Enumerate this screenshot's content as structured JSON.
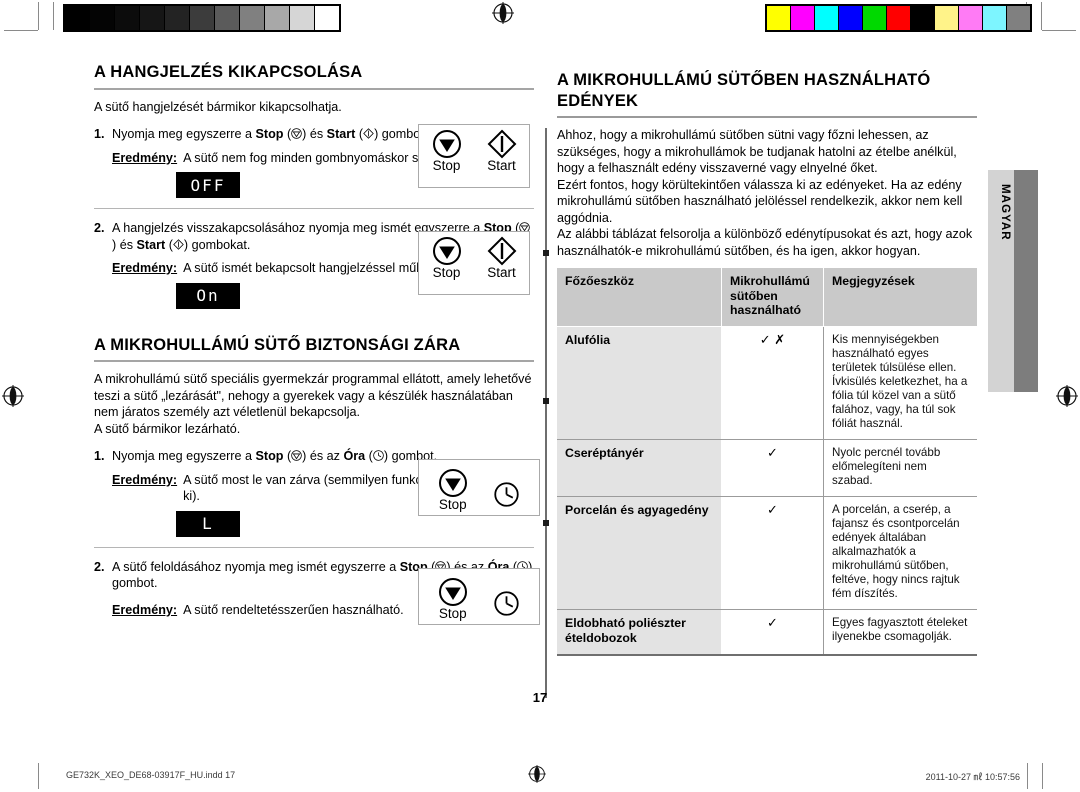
{
  "document": {
    "page_number": "17",
    "side_tab_label": "MAGYAR",
    "footer_file": "GE732K_XEO_DE68-03917F_HU.indd   17",
    "footer_timestamp": "2011-10-27   ㎖ 10:57:56"
  },
  "calibration": {
    "grayscale_swatches": [
      "#000000",
      "#040404",
      "#0c0c0c",
      "#161616",
      "#232323",
      "#3c3c3c",
      "#5b5b5b",
      "#808080",
      "#a8a8a8",
      "#d6d6d6",
      "#ffffff"
    ],
    "color_swatches": [
      "#ffff00",
      "#ff00ff",
      "#00ffff",
      "#0000ff",
      "#00d900",
      "#ff0000",
      "#000000",
      "#fff389",
      "#ff7bf5",
      "#7df5ff",
      "#808080"
    ]
  },
  "left_column": {
    "section1": {
      "heading": "A HANGJELZÉS KIKAPCSOLÁSA",
      "intro": "A sütő hangjelzését bármikor kikapcsolhatja.",
      "steps": [
        {
          "num": "1.",
          "text_parts": [
            "Nyomja meg egyszerre a ",
            "Stop",
            " (",
            ") és ",
            "Start",
            " (",
            ") gombokat."
          ],
          "result_label": "Eredmény:",
          "result_text": "A sütő nem fog minden gombnyomáskor sípolni.",
          "lcd": "OFF",
          "panel": {
            "keys": [
              {
                "icon": "stop-icon",
                "label": "Stop"
              },
              {
                "icon": "start-icon",
                "label": "Start"
              }
            ]
          }
        },
        {
          "num": "2.",
          "text_parts": [
            "A hangjelzés visszakapcsolásához nyomja meg ismét egyszerre a ",
            "Stop",
            " (",
            ") és ",
            "Start",
            " (",
            ") gombokat."
          ],
          "result_label": "Eredmény:",
          "result_text": "A sütő ismét bekapcsolt hangjelzéssel működik.",
          "lcd": "On",
          "panel": {
            "keys": [
              {
                "icon": "stop-icon",
                "label": "Stop"
              },
              {
                "icon": "start-icon",
                "label": "Start"
              }
            ]
          }
        }
      ]
    },
    "section2": {
      "heading": "A MIKROHULLÁMÚ SÜTŐ BIZTONSÁGI ZÁRA",
      "intro_line1": "A mikrohullámú sütő speciális gyermekzár programmal ellátott, amely lehetővé teszi a sütő „lezárását\", nehogy a gyerekek vagy a készülék használatában nem járatos személy azt véletlenül bekapcsolja.",
      "intro_line2": "A sütő bármikor lezárható.",
      "steps": [
        {
          "num": "1.",
          "text_parts": [
            "Nyomja meg egyszerre a ",
            "Stop",
            " (",
            ") és az ",
            "Óra",
            " (",
            ") gombot."
          ],
          "result_label": "Eredmény:",
          "result_text": "A sütő most le van zárva (semmilyen funkció nem választható ki).",
          "lcd": "L",
          "panel": {
            "keys": [
              {
                "icon": "stop-icon",
                "label": "Stop"
              },
              {
                "icon": "clock-icon",
                "label": ""
              }
            ]
          }
        },
        {
          "num": "2.",
          "text_parts": [
            "A sütő feloldásához nyomja meg ismét egyszerre a ",
            "Stop",
            " (",
            ") és az ",
            "Óra",
            " (",
            ") gombot."
          ],
          "result_label": "Eredmény:",
          "result_text": "A sütő rendeltetésszerűen használható.",
          "lcd": "",
          "panel": {
            "keys": [
              {
                "icon": "stop-icon",
                "label": "Stop"
              },
              {
                "icon": "clock-icon",
                "label": ""
              }
            ]
          }
        }
      ]
    }
  },
  "right_column": {
    "heading_line1": "A MIKROHULLÁMÚ SÜTŐBEN HASZNÁLHATÓ",
    "heading_line2": "EDÉNYEK",
    "paragraph1": "Ahhoz, hogy a mikrohullámú sütőben sütni vagy főzni lehessen, az szükséges, hogy a mikrohullámok be tudjanak hatolni az ételbe anélkül, hogy a felhasznált edény visszaverné vagy elnyelné őket.",
    "paragraph2": "Ezért fontos, hogy körültekintően válassza ki az edényeket. Ha az edény mikrohullámú sütőben használható jelöléssel rendelkezik, akkor nem kell aggódnia.",
    "paragraph3": "Az alábbi táblázat felsorolja a különböző edénytípusokat és azt, hogy azok használhatók-e mikrohullámú sütőben, és ha igen, akkor hogyan.",
    "table": {
      "headers": [
        "Főzőeszköz",
        "Mikrohullámú sütőben használható",
        "Megjegyzések"
      ],
      "rows": [
        {
          "name": "Alufólia",
          "mark": "✓ ✗",
          "note": "Kis mennyiségekben használható egyes területek túlsülése ellen. Ívkisülés keletkezhet, ha a fólia túl közel van a sütő falához, vagy, ha túl sok fóliát használ."
        },
        {
          "name": "Cseréptányér",
          "mark": "✓",
          "note": "Nyolc percnél tovább előmelegíteni nem szabad."
        },
        {
          "name": "Porcelán és agyagedény",
          "mark": "✓",
          "note": "A porcelán, a cserép, a fajansz és csontporcelán edények általában alkalmazhatók a mikrohullámú sütőben, feltéve, hogy nincs rajtuk fém díszítés."
        },
        {
          "name": "Eldobható poliészter ételdobozok",
          "mark": "✓",
          "note": "Egyes fagyasztott ételeket ilyenekbe csomagolják."
        }
      ]
    }
  }
}
